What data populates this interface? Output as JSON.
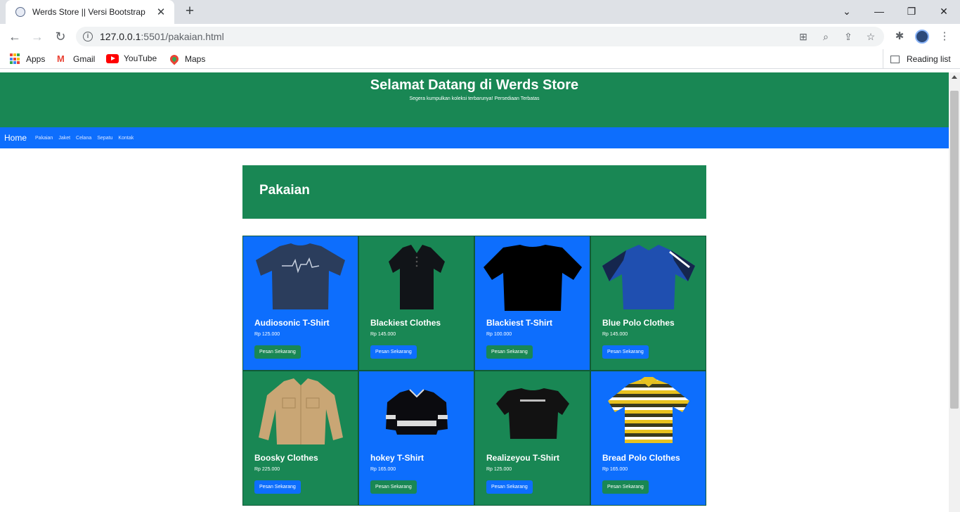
{
  "browser": {
    "tab_title": "Werds Store || Versi Bootstrap",
    "url_host": "127.0.0.1",
    "url_rest": ":5501/pakaian.html",
    "bookmarks": [
      "Apps",
      "Gmail",
      "YouTube",
      "Maps"
    ],
    "reading_list": "Reading list"
  },
  "hero": {
    "title": "Selamat Datang di Werds Store",
    "subtitle": "Segera kumpulkan koleksi terbarunya! Persediaan Terbatas"
  },
  "nav": {
    "brand": "Home",
    "links": [
      "Pakaian",
      "Jaket",
      "Celana",
      "Sepatu",
      "Kontak"
    ]
  },
  "section": {
    "title": "Pakaian"
  },
  "products": [
    {
      "name": "Audiosonic T-Shirt",
      "price": "Rp 125.000",
      "button": "Pesan Sekarang",
      "theme": "blue",
      "icon": "navy-tshirt-image"
    },
    {
      "name": "Blackiest Clothes",
      "price": "Rp 145.000",
      "button": "Pesan Sekarang",
      "theme": "green",
      "icon": "black-polo-image"
    },
    {
      "name": "Blackiest T-Shirt",
      "price": "Rp 100.000",
      "button": "Pesan Sekarang",
      "theme": "blue",
      "icon": "black-tshirt-image"
    },
    {
      "name": "Blue Polo Clothes",
      "price": "Rp 145.000",
      "button": "Pesan Sekarang",
      "theme": "green",
      "icon": "blue-polo-image"
    },
    {
      "name": "Boosky Clothes",
      "price": "Rp 225.000",
      "button": "Pesan Sekarang",
      "theme": "green",
      "icon": "tan-shirt-image"
    },
    {
      "name": "hokey T-Shirt",
      "price": "Rp 165.000",
      "button": "Pesan Sekarang",
      "theme": "blue",
      "icon": "hockey-jersey-image"
    },
    {
      "name": "Realizeyou T-Shirt",
      "price": "Rp 125.000",
      "button": "Pesan Sekarang",
      "theme": "green",
      "icon": "black-graphic-tshirt-image"
    },
    {
      "name": "Bread Polo Clothes",
      "price": "Rp 165.000",
      "button": "Pesan Sekarang",
      "theme": "blue",
      "icon": "striped-polo-image"
    }
  ],
  "colors": {
    "green": "#198754",
    "blue": "#0d6efd"
  }
}
